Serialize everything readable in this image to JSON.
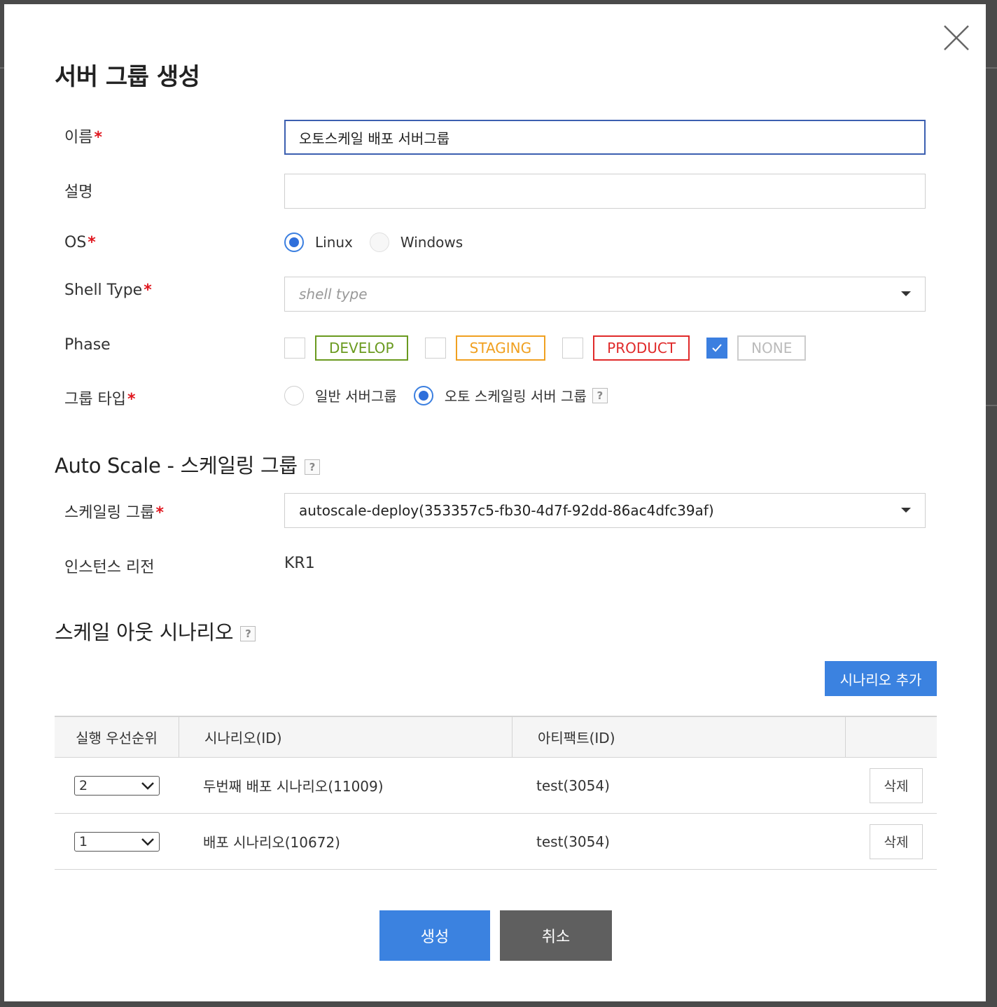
{
  "modal": {
    "title": "서버 그룹 생성",
    "close_icon": "close-icon"
  },
  "form": {
    "name": {
      "label": "이름",
      "value": "오토스케일 배포 서버그룹"
    },
    "description": {
      "label": "설명",
      "value": ""
    },
    "os": {
      "label": "OS",
      "options": [
        "Linux",
        "Windows"
      ],
      "selected": "Linux"
    },
    "shell_type": {
      "label": "Shell Type",
      "placeholder": "shell type"
    },
    "phase": {
      "label": "Phase",
      "options": [
        {
          "label": "DEVELOP",
          "checked": false,
          "color": "#6a9a1f"
        },
        {
          "label": "STAGING",
          "checked": false,
          "color": "#f0a020"
        },
        {
          "label": "PRODUCT",
          "checked": false,
          "color": "#e02a2a"
        },
        {
          "label": "NONE",
          "checked": true,
          "color": "#bbbbbb"
        }
      ]
    },
    "group_type": {
      "label": "그룹 타입",
      "options": [
        "일반 서버그룹",
        "오토 스케일링 서버 그룹"
      ],
      "selected": "오토 스케일링 서버 그룹",
      "help": "?"
    }
  },
  "autoscale": {
    "heading": "Auto Scale - 스케일링 그룹",
    "help": "?",
    "scaling_group": {
      "label": "스케일링 그룹",
      "value": "autoscale-deploy(353357c5-fb30-4d7f-92dd-86ac4dfc39af)"
    },
    "region": {
      "label": "인스턴스 리전",
      "value": "KR1"
    }
  },
  "scaleout": {
    "heading": "스케일 아웃 시나리오",
    "help": "?",
    "add_button": "시나리오 추가",
    "columns": [
      "실행 우선순위",
      "시나리오(ID)",
      "아티팩트(ID)",
      ""
    ],
    "rows": [
      {
        "priority": "2",
        "scenario": "두번째 배포 시나리오(11009)",
        "artifact": "test(3054)",
        "delete": "삭제"
      },
      {
        "priority": "1",
        "scenario": "배포 시나리오(10672)",
        "artifact": "test(3054)",
        "delete": "삭제"
      }
    ]
  },
  "footer": {
    "create": "생성",
    "cancel": "취소"
  },
  "colors": {
    "primary": "#3b82e0",
    "required": "#e0171f",
    "dark_button": "#5f5f5f",
    "focus_border": "#3c5fb0"
  }
}
